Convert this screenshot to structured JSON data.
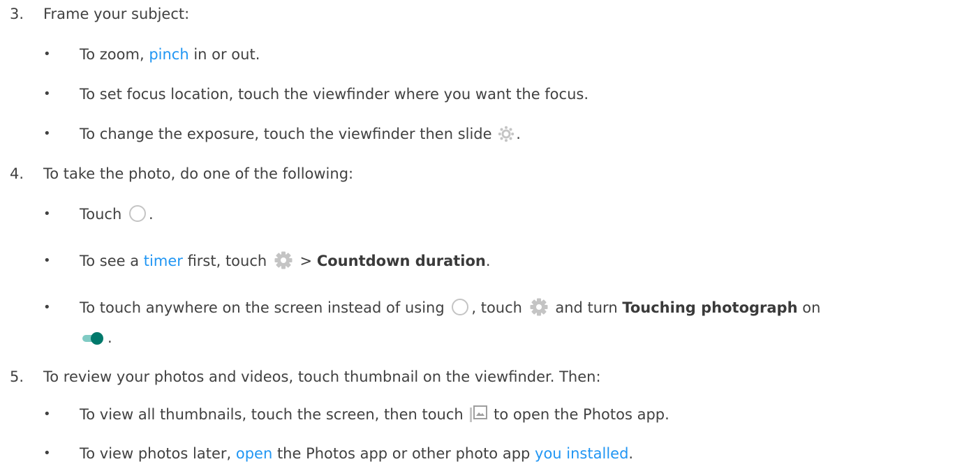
{
  "steps": [
    {
      "number": "3.",
      "text": "Frame your subject:",
      "bullets": [
        {
          "pre": "To zoom, ",
          "link": "pinch",
          "post": " in or out."
        },
        {
          "text": "To set focus location, touch the viewfinder where you want the focus."
        },
        {
          "pre": "To change the exposure, touch the viewfinder then slide ",
          "icon": "exposure-sun-icon",
          "post": "."
        }
      ]
    },
    {
      "number": "4.",
      "text": "To take the photo, do one of the following:",
      "bullets": [
        {
          "pre": "Touch ",
          "icon": "shutter-circle-icon",
          "post": "."
        },
        {
          "pre": "To see a ",
          "link": "timer",
          "mid": " first, touch ",
          "icon": "settings-gear-icon",
          "mid2": " > ",
          "bold": "Countdown duration",
          "post": "."
        },
        {
          "pre": "To touch anywhere on the screen instead of using ",
          "icon1": "shutter-circle-icon",
          "mid": ", touch ",
          "icon2": "settings-gear-icon",
          "mid2": " and turn ",
          "bold": "Touching photograph",
          "post": " on",
          "icon3": "toggle-on-icon",
          "post2": "."
        }
      ]
    },
    {
      "number": "5.",
      "text": "To review your photos and videos, touch thumbnail on the viewfinder. Then:",
      "bullets": [
        {
          "pre": "To view all thumbnails, touch the screen, then touch ",
          "icon": "photos-gallery-icon",
          "post": " to open the Photos app."
        },
        {
          "pre": "To view photos later, ",
          "link": "open",
          "mid": " the Photos app or other photo app ",
          "link2": "you installed",
          "post": "."
        }
      ]
    }
  ],
  "bullet_char": "•",
  "colors": {
    "text": "#414141",
    "link": "#2196f3",
    "toggle": "#00796b",
    "toggle_track": "#80cbc4",
    "icon_gray": "#c4c4c4"
  }
}
